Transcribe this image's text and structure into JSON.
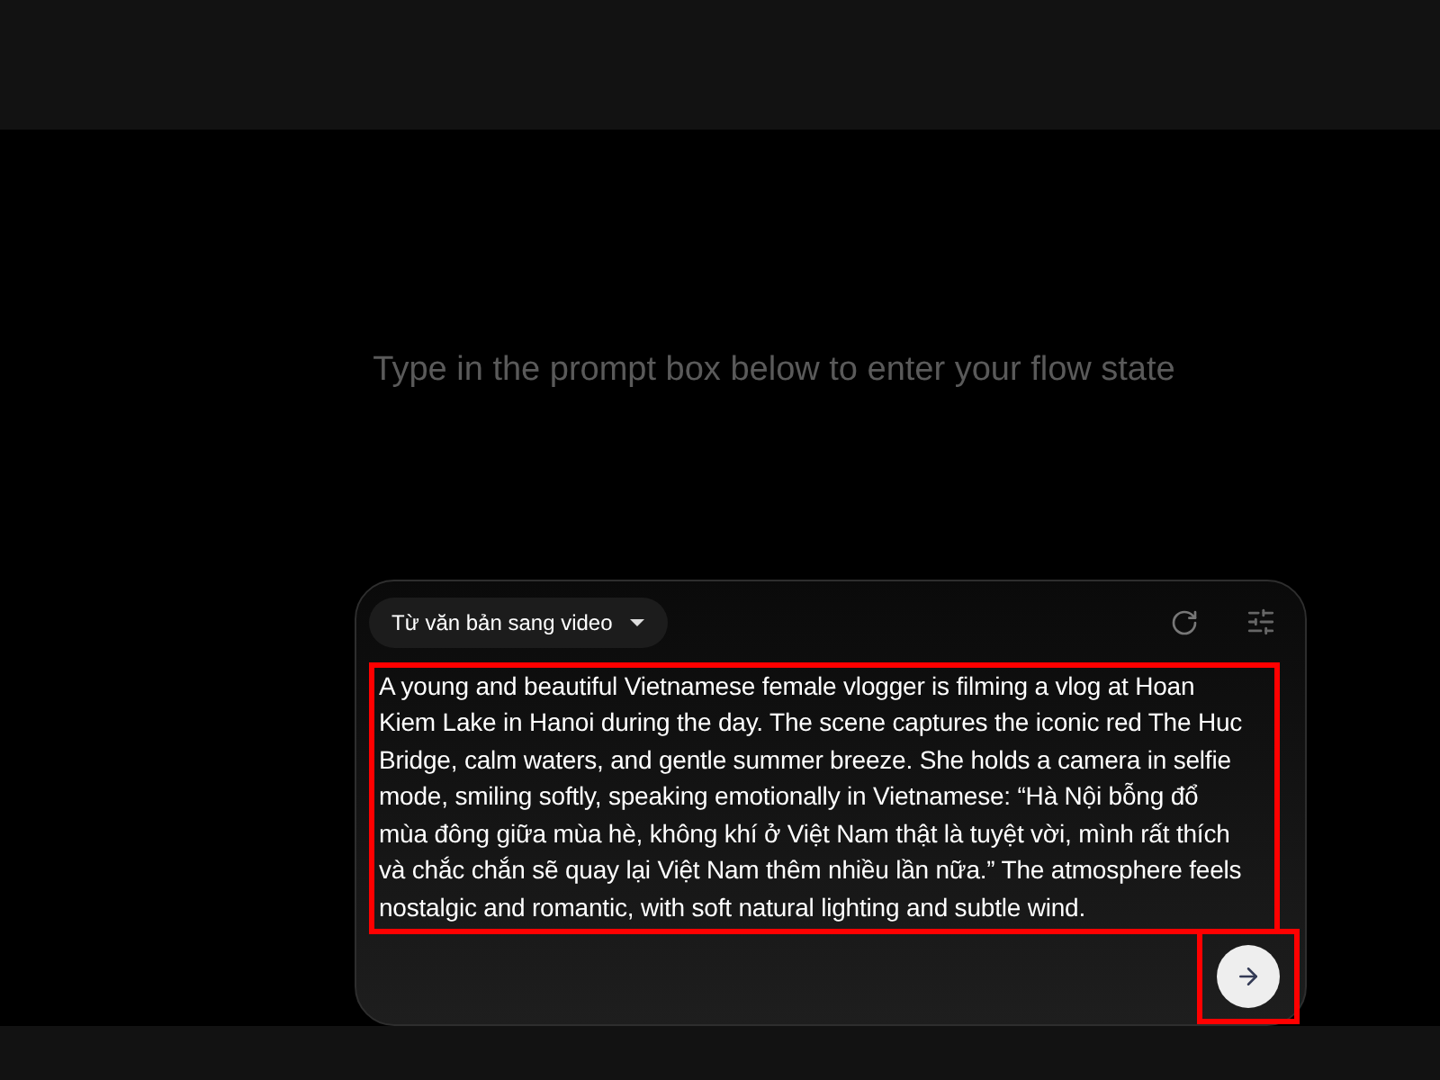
{
  "hint": "Type in the prompt box below to enter your flow state",
  "composer": {
    "mode": "Từ văn bản sang video",
    "prompt_lines": [
      "A young and beautiful Vietnamese female vlogger is filming a vlog at Hoan",
      "Kiem Lake in Hanoi during the day. The scene captures the iconic red The Huc",
      "Bridge, calm waters, and gentle summer breeze. She holds a camera in selfie",
      "mode, smiling softly, speaking emotionally in Vietnamese: “Hà Nội bỗng đổ",
      "mùa đông giữa mùa hè, không khí ở Việt Nam thật là tuyệt vời, mình rất thích",
      "và chắc chắn sẽ quay lại Việt Nam thêm nhiều lần nữa.” The atmosphere feels",
      "nostalgic and romantic, with soft natural lighting and subtle wind."
    ],
    "prompt_highlighted": true,
    "send_highlighted": true
  }
}
